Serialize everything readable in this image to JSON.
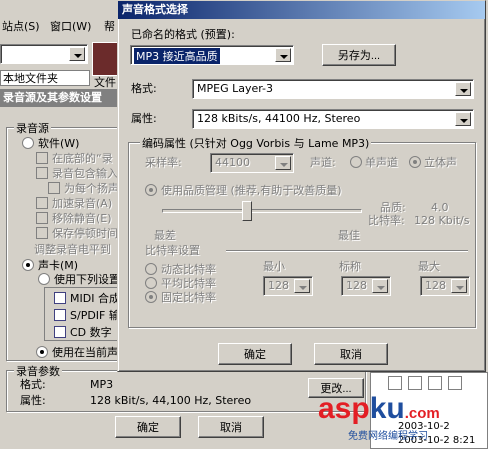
{
  "background": {
    "menu_items": [
      "站点(S)",
      "窗口(W)",
      "帮"
    ],
    "folder_text": "本地文件夹",
    "file_tab": "文件",
    "panel_title": "录音源及其参数设置",
    "source_group": "录音源",
    "software_label": "软件(W)",
    "software_options": [
      "在底部的“录",
      "录音包含输入",
      "为每个扬声",
      "加速录音(A)",
      "移除静音(E)",
      "保存停顿时间"
    ],
    "adjust_text": "调整录音电平到",
    "soundcard_label": "声卡(M)",
    "use_following_label": "使用下列设置",
    "devices": [
      "MIDI 合成",
      "S/PDIF 输",
      "CD 数字"
    ],
    "use_current_label": "使用在当前声",
    "params_group": "录音参数",
    "format_label": "格式:",
    "format_value": "MP3",
    "attr_label": "属性:",
    "attr_value": "128 kBit/s, 44,100 Hz, Stereo",
    "change_button": "更改...",
    "ok_button": "确定",
    "cancel_button": "取消",
    "timestamps": [
      "2003-10-2",
      "2003-10-2 8:21"
    ],
    "watermark_main": "asp",
    "watermark_ku": "ku",
    "watermark_com": ".com",
    "watermark_sub": "免费网络编程学习"
  },
  "dialog": {
    "title": "声音格式选择",
    "preset_label": "已命名的格式 (预置):",
    "preset_value": "MP3 接近高品质",
    "save_as_button": "另存为...",
    "format_label": "格式:",
    "format_value": "MPEG Layer-3",
    "attributes_label": "属性:",
    "attributes_value": "128 kBits/s, 44100 Hz, Stereo",
    "codec_group_label": "编码属性 (只针对 Ogg Vorbis 与 Lame MP3)",
    "sample_rate_label": "采样率:",
    "sample_rate_value": "44100",
    "channel_label": "声道:",
    "mono_label": "单声道",
    "stereo_label": "立体声",
    "quality_mode_label": "使用品质管理 (推荐,有助于改善质量)",
    "quality_label": "品质:",
    "quality_value": "4.0",
    "bitrate_readout_label": "比特率:",
    "bitrate_readout_value": "128 Kbit/s",
    "worst_label": "最差",
    "best_label": "最佳",
    "bitrate_settings_label": "比特率设置",
    "vbr_label": "动态比特率",
    "abr_label": "平均比特率",
    "cbr_label": "固定比特率",
    "min_label": "最小",
    "nominal_label": "标称",
    "max_label": "最大",
    "min_value": "128",
    "nominal_value": "128",
    "max_value": "128",
    "ok_button": "确定",
    "cancel_button": "取消",
    "quality_slider_position": 0.42
  },
  "colors": {
    "title_start": "#0a246a",
    "title_end": "#a6caf0",
    "selection": "#0a246a",
    "watermark_red": "#e31e24",
    "watermark_blue": "#1f4e9e"
  }
}
